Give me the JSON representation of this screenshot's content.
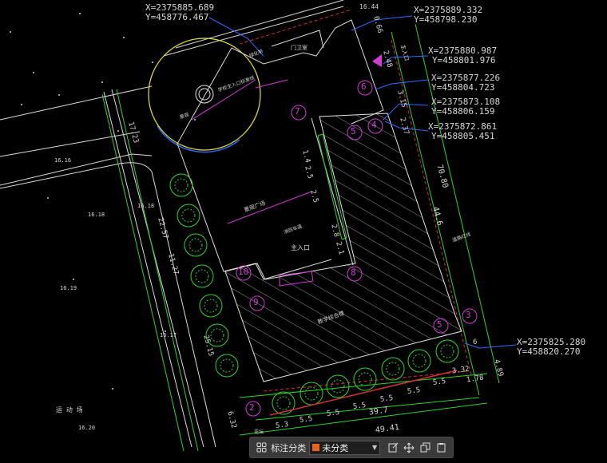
{
  "coords": [
    {
      "x": "X=2375885.689",
      "y": "Y=458776.467"
    },
    {
      "x": "X=2375889.332",
      "y": "Y=458798.230"
    },
    {
      "x": "X=2375880.987",
      "y": "Y=458801.976"
    },
    {
      "x": "X=2375877.226",
      "y": "Y=458804.723"
    },
    {
      "x": "X=2375873.108",
      "y": "Y=458806.159"
    },
    {
      "x": "X=2375872.861",
      "y": "Y=458805.451"
    },
    {
      "x": "X=2375825.280",
      "y": "Y=458820.270"
    }
  ],
  "dimensions": {
    "top_a": "16.44",
    "d_066": "0.66",
    "d_248": "2.48",
    "d_315": "3.15",
    "d_237": "2.37",
    "d_7080": "70.80",
    "d_446": "44.6",
    "d_6": "6",
    "d_489": "4.89",
    "d_332": "3.32",
    "d_178": "1.78",
    "d_397": "39.7",
    "d_4941": "49.41",
    "d_632": "6.32",
    "d_2257": "22.57",
    "d_1127": "11.27",
    "d_2515": "25.15",
    "d_1723": "17.23",
    "d_55": "5.5",
    "d_53": "5.3",
    "d_25": "2.5",
    "d_28": "2.8",
    "d_14": "1.4",
    "d_21": "2.1"
  },
  "elevations": [
    "16.16",
    "16.18",
    "16.18",
    "16.19",
    "16.17",
    "16.20"
  ],
  "circle_labels": [
    "6",
    "7",
    "5",
    "4",
    "10",
    "9",
    "8",
    "2",
    "3",
    "5"
  ],
  "plan_labels": {
    "main_entrance": "主入口",
    "main_entrance_b": "主入口",
    "plaza": "景观广场",
    "building": "教学综合楼",
    "gate": "门卫室",
    "school_gate_axis": "学校主入口标准线",
    "landscape": "景观",
    "flower": "花坛",
    "fire_lane": "消防车道",
    "sports_field": "运 动 场",
    "greenbelt": "绿化带",
    "line_label": "道路红线"
  },
  "toolbar": {
    "label": "标注分类",
    "selected": "未分类",
    "swatch_color": "#e8641e"
  },
  "colors": {
    "cyan": "#1fd2e8",
    "green": "#2bd52b",
    "magenta": "#d43bd4",
    "yellow": "#e6e62e",
    "red": "#d23232",
    "white": "#e6e6e6",
    "blue": "#2f6bff"
  }
}
